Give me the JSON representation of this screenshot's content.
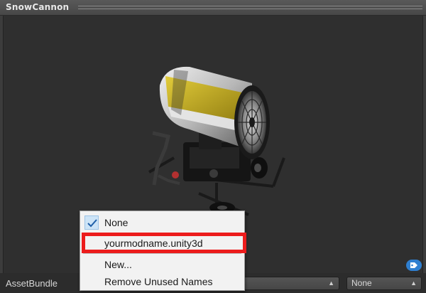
{
  "header": {
    "title": "SnowCannon"
  },
  "footer": {
    "assetbundle_label": "AssetBundle",
    "variant_select_value": "None"
  },
  "menu": {
    "items": [
      {
        "label": "None",
        "checked": true
      },
      {
        "label": "yourmodname.unity3d",
        "checked": false,
        "highlighted": true
      },
      {
        "label": "New...",
        "checked": false
      },
      {
        "label": "Remove Unused Names",
        "checked": false
      }
    ]
  },
  "colors": {
    "highlight_box": "#ec1c1c",
    "tag_button": "#2f7fd0",
    "cannon_yellow": "#c9b21a"
  }
}
